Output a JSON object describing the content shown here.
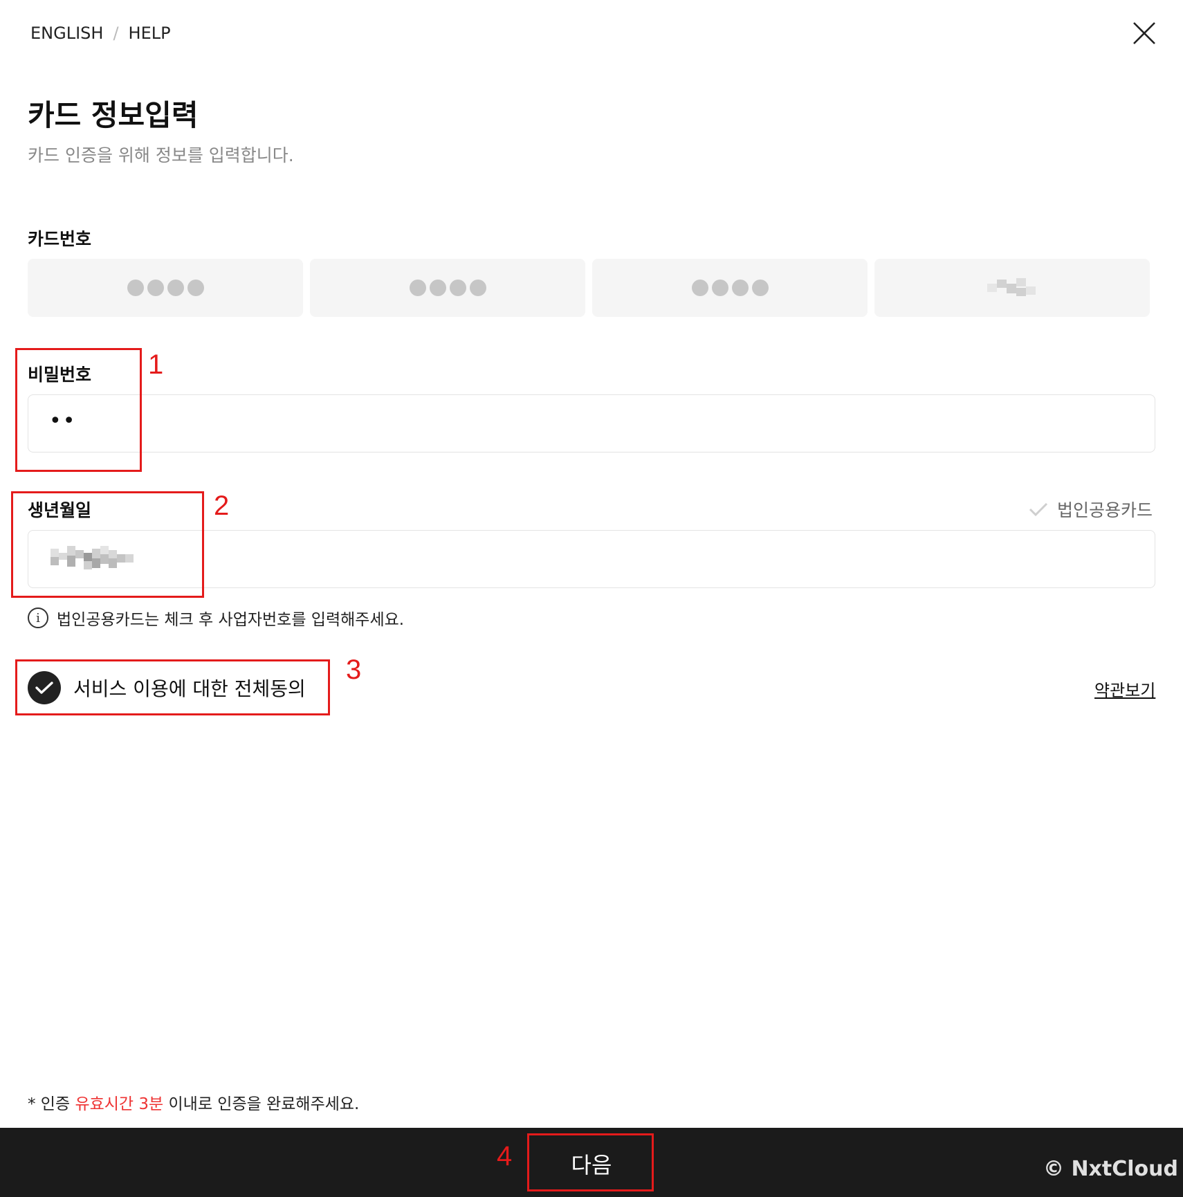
{
  "topnav": {
    "lang": "ENGLISH",
    "separator": "/",
    "help": "HELP"
  },
  "icons": {
    "close": "close-icon",
    "info": "info-icon",
    "check": "check-icon"
  },
  "header": {
    "title": "카드 정보입력",
    "subtitle": "카드 인증을 위해 정보를 입력합니다."
  },
  "card": {
    "label": "카드번호",
    "segments": [
      "●●●●",
      "●●●●",
      "●●●●",
      "(blurred)"
    ]
  },
  "password": {
    "label": "비밀번호",
    "value": "••"
  },
  "dob": {
    "label": "생년월일",
    "value": "(blurred)"
  },
  "corporate_card": {
    "label": "법인공용카드",
    "checked": false
  },
  "info": {
    "text": "법인공용카드는 체크 후 사업자번호를 입력해주세요."
  },
  "agree": {
    "label": "서비스 이용에 대한 전체동의",
    "checked": true,
    "terms_link": "약관보기"
  },
  "footnote": {
    "prefix": "* 인증 ",
    "highlight": "유효시간 3분",
    "suffix": " 이내로 인증을 완료해주세요."
  },
  "footer": {
    "next_button": "다음",
    "watermark": "© NxtCloud"
  },
  "annotations": [
    "1",
    "2",
    "3",
    "4"
  ],
  "colors": {
    "annotation": "#e41b1b",
    "accent_red": "#ee3333",
    "bottom_bar": "#1b1b1b"
  }
}
